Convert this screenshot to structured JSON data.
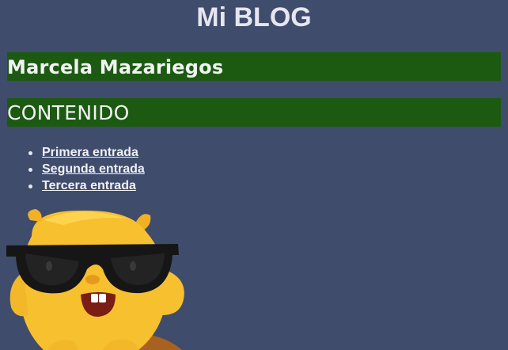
{
  "page": {
    "title": "Mi BLOG"
  },
  "author": {
    "name": "Marcela Mazariegos"
  },
  "section": {
    "heading": "CONTENIDO"
  },
  "nav": {
    "items": [
      {
        "label": "Primera entrada"
      },
      {
        "label": "Segunda entrada"
      },
      {
        "label": "Tercera entrada"
      }
    ]
  },
  "colors": {
    "background": "#3f4c6c",
    "band": "#1c5a12",
    "mascot_body": "#f7c02f",
    "sunglasses": "#161616"
  },
  "image": {
    "icon": "mascot-with-sunglasses-icon"
  }
}
